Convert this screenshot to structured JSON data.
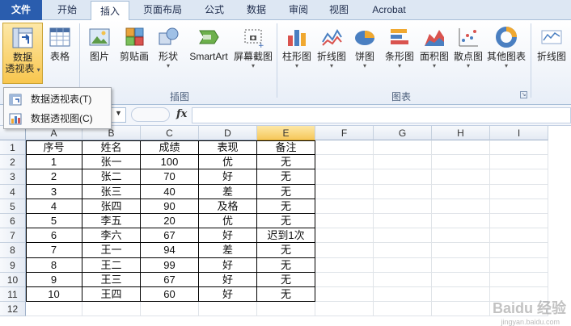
{
  "tabs": [
    {
      "label": "文件"
    },
    {
      "label": "开始"
    },
    {
      "label": "插入"
    },
    {
      "label": "页面布局"
    },
    {
      "label": "公式"
    },
    {
      "label": "数据"
    },
    {
      "label": "审阅"
    },
    {
      "label": "视图"
    },
    {
      "label": "Acrobat"
    }
  ],
  "ribbon": {
    "pivot_line1": "数据",
    "pivot_line2": "透视表",
    "table": "表格",
    "picture": "图片",
    "clipart": "剪贴画",
    "shapes": "形状",
    "smartart": "SmartArt",
    "screenshot": "屏幕截图",
    "column_chart": "柱形图",
    "line_chart": "折线图",
    "pie_chart": "饼图",
    "bar_chart": "条形图",
    "area_chart": "面积图",
    "scatter_chart": "散点图",
    "other_chart": "其他图表",
    "sparkline_line": "折线图",
    "group_illustrations": "插图",
    "group_charts": "图表",
    "fx_symbol": "fx"
  },
  "menu": {
    "item1": "数据透视表(T)",
    "item2": "数据透视图(C)"
  },
  "columns": [
    "A",
    "B",
    "C",
    "D",
    "E",
    "F",
    "G",
    "H",
    "I"
  ],
  "rows": [
    "1",
    "2",
    "3",
    "4",
    "5",
    "6",
    "7",
    "8",
    "9",
    "10",
    "11",
    "12"
  ],
  "table": {
    "rows": [
      [
        "序号",
        "姓名",
        "成绩",
        "表现",
        "备注"
      ],
      [
        "1",
        "张一",
        "100",
        "优",
        "无"
      ],
      [
        "2",
        "张二",
        "70",
        "好",
        "无"
      ],
      [
        "3",
        "张三",
        "40",
        "差",
        "无"
      ],
      [
        "4",
        "张四",
        "90",
        "及格",
        "无"
      ],
      [
        "5",
        "李五",
        "20",
        "优",
        "无"
      ],
      [
        "6",
        "李六",
        "67",
        "好",
        "迟到1次"
      ],
      [
        "7",
        "王一",
        "94",
        "差",
        "无"
      ],
      [
        "8",
        "王二",
        "99",
        "好",
        "无"
      ],
      [
        "9",
        "王三",
        "67",
        "好",
        "无"
      ],
      [
        "10",
        "王四",
        "60",
        "好",
        "无"
      ]
    ]
  },
  "watermark": {
    "main": "Baidu 经验",
    "sub": "jingyan.baidu.com"
  },
  "colors": {
    "file_tab": "#2a5dae",
    "selected_header": "#f6c75a",
    "accent_blue": "#2a5dae"
  }
}
